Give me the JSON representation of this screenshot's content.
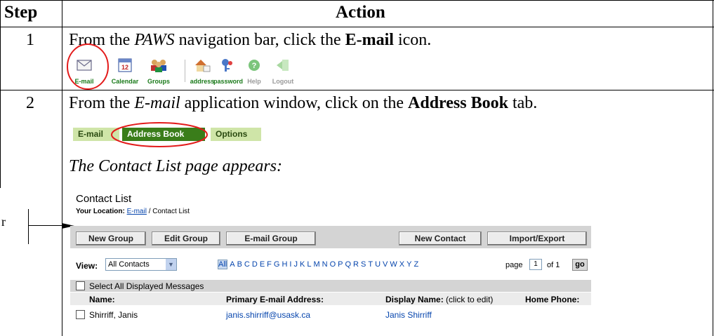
{
  "table": {
    "header_step": "Step",
    "header_action": "Action"
  },
  "step1": {
    "number": "1",
    "text_pre": "From the ",
    "text_paws": "PAWS",
    "text_mid": " navigation bar, click the ",
    "text_email": "E-mail",
    "text_post": " icon.",
    "nav_items": [
      {
        "label": "E-mail",
        "icon": "envelope-icon"
      },
      {
        "label": "Calendar",
        "icon": "calendar-icon"
      },
      {
        "label": "Groups",
        "icon": "groups-icon"
      },
      {
        "label": "address",
        "icon": "address-home-icon"
      },
      {
        "label": "password",
        "icon": "password-key-icon"
      },
      {
        "label": "Help",
        "icon": "help-icon"
      },
      {
        "label": "Logout",
        "icon": "logout-icon"
      }
    ]
  },
  "step2": {
    "number": "2",
    "text_pre": "From the ",
    "text_app": "E-mail",
    "text_mid": " application window, click on the ",
    "text_tab": "Address Book",
    "text_post": " tab.",
    "tabs": [
      "E-mail",
      "Address Book",
      "Options"
    ],
    "appears": "The Contact List page appears:"
  },
  "side_label": "r",
  "contact_list": {
    "title": "Contact List",
    "location_label": "Your Location:",
    "location_link": "E-mail",
    "location_rest": " / Contact List",
    "buttons": {
      "new_group": "New Group",
      "edit_group": "Edit Group",
      "email_group": "E-mail Group",
      "new_contact": "New Contact",
      "import_export": "Import/Export"
    },
    "view_label": "View:",
    "view_value": "All Contacts",
    "alphabet": [
      "All",
      "A",
      "B",
      "C",
      "D",
      "E",
      "F",
      "G",
      "H",
      "I",
      "J",
      "K",
      "L",
      "M",
      "N",
      "O",
      "P",
      "Q",
      "R",
      "S",
      "T",
      "U",
      "V",
      "W",
      "X",
      "Y",
      "Z"
    ],
    "page_label": "page",
    "page_value": "1",
    "page_of": "of 1",
    "go": "go",
    "select_all": "Select All Displayed Messages",
    "columns": {
      "name": "Name:",
      "email": "Primary E-mail Address:",
      "display": "Display Name:",
      "display_hint": "(click to edit)",
      "phone": "Home Phone:"
    },
    "rows": [
      {
        "name": "Shirriff, Janis",
        "email": "janis.shirriff@usask.ca",
        "display": "Janis Shirriff"
      }
    ]
  },
  "colors": {
    "tab_active": "#3a7d1a",
    "tab_inactive": "#cfe5a8",
    "highlight_circle": "#e31b1b",
    "link": "#0645ad"
  }
}
